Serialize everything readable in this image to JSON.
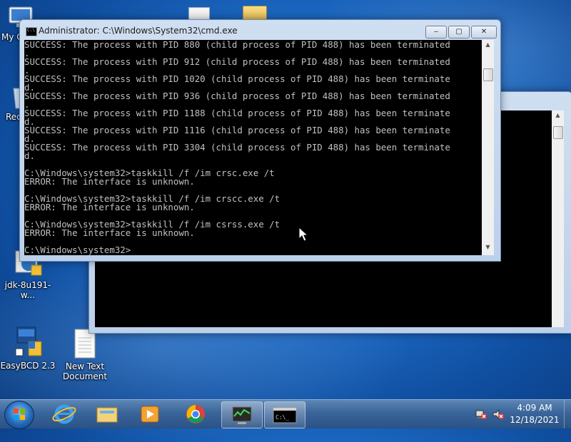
{
  "desktop": {
    "icons": [
      {
        "label": "My C",
        "name": "computer"
      },
      {
        "label": "Rec",
        "name": "recycle-bin"
      },
      {
        "label": "jdk-8u191-w...",
        "name": "jdk-installer"
      },
      {
        "label": "EasyBCD 2.3",
        "name": "easybcd"
      },
      {
        "label": "New Text Document",
        "name": "new-text-document"
      }
    ]
  },
  "front_window": {
    "title": "Administrator: C:\\Windows\\System32\\cmd.exe",
    "lines": [
      "SUCCESS: The process with PID 880 (child process of PID 488) has been terminated",
      ".",
      "SUCCESS: The process with PID 912 (child process of PID 488) has been terminated",
      ".",
      "SUCCESS: The process with PID 1020 (child process of PID 488) has been terminate",
      "d.",
      "SUCCESS: The process with PID 936 (child process of PID 488) has been terminated",
      ".",
      "SUCCESS: The process with PID 1188 (child process of PID 488) has been terminate",
      "d.",
      "SUCCESS: The process with PID 1116 (child process of PID 488) has been terminate",
      "d.",
      "SUCCESS: The process with PID 3304 (child process of PID 488) has been terminate",
      "d.",
      "",
      "C:\\Windows\\system32>taskkill /f /im crsc.exe /t",
      "ERROR: The interface is unknown.",
      "",
      "C:\\Windows\\system32>taskkill /f /im crscc.exe /t",
      "ERROR: The interface is unknown.",
      "",
      "C:\\Windows\\system32>taskkill /f /im csrss.exe /t",
      "ERROR: The interface is unknown.",
      "",
      "C:\\Windows\\system32>"
    ]
  },
  "taskbar": {
    "time": "4:09 AM",
    "date": "12/18/2021"
  }
}
